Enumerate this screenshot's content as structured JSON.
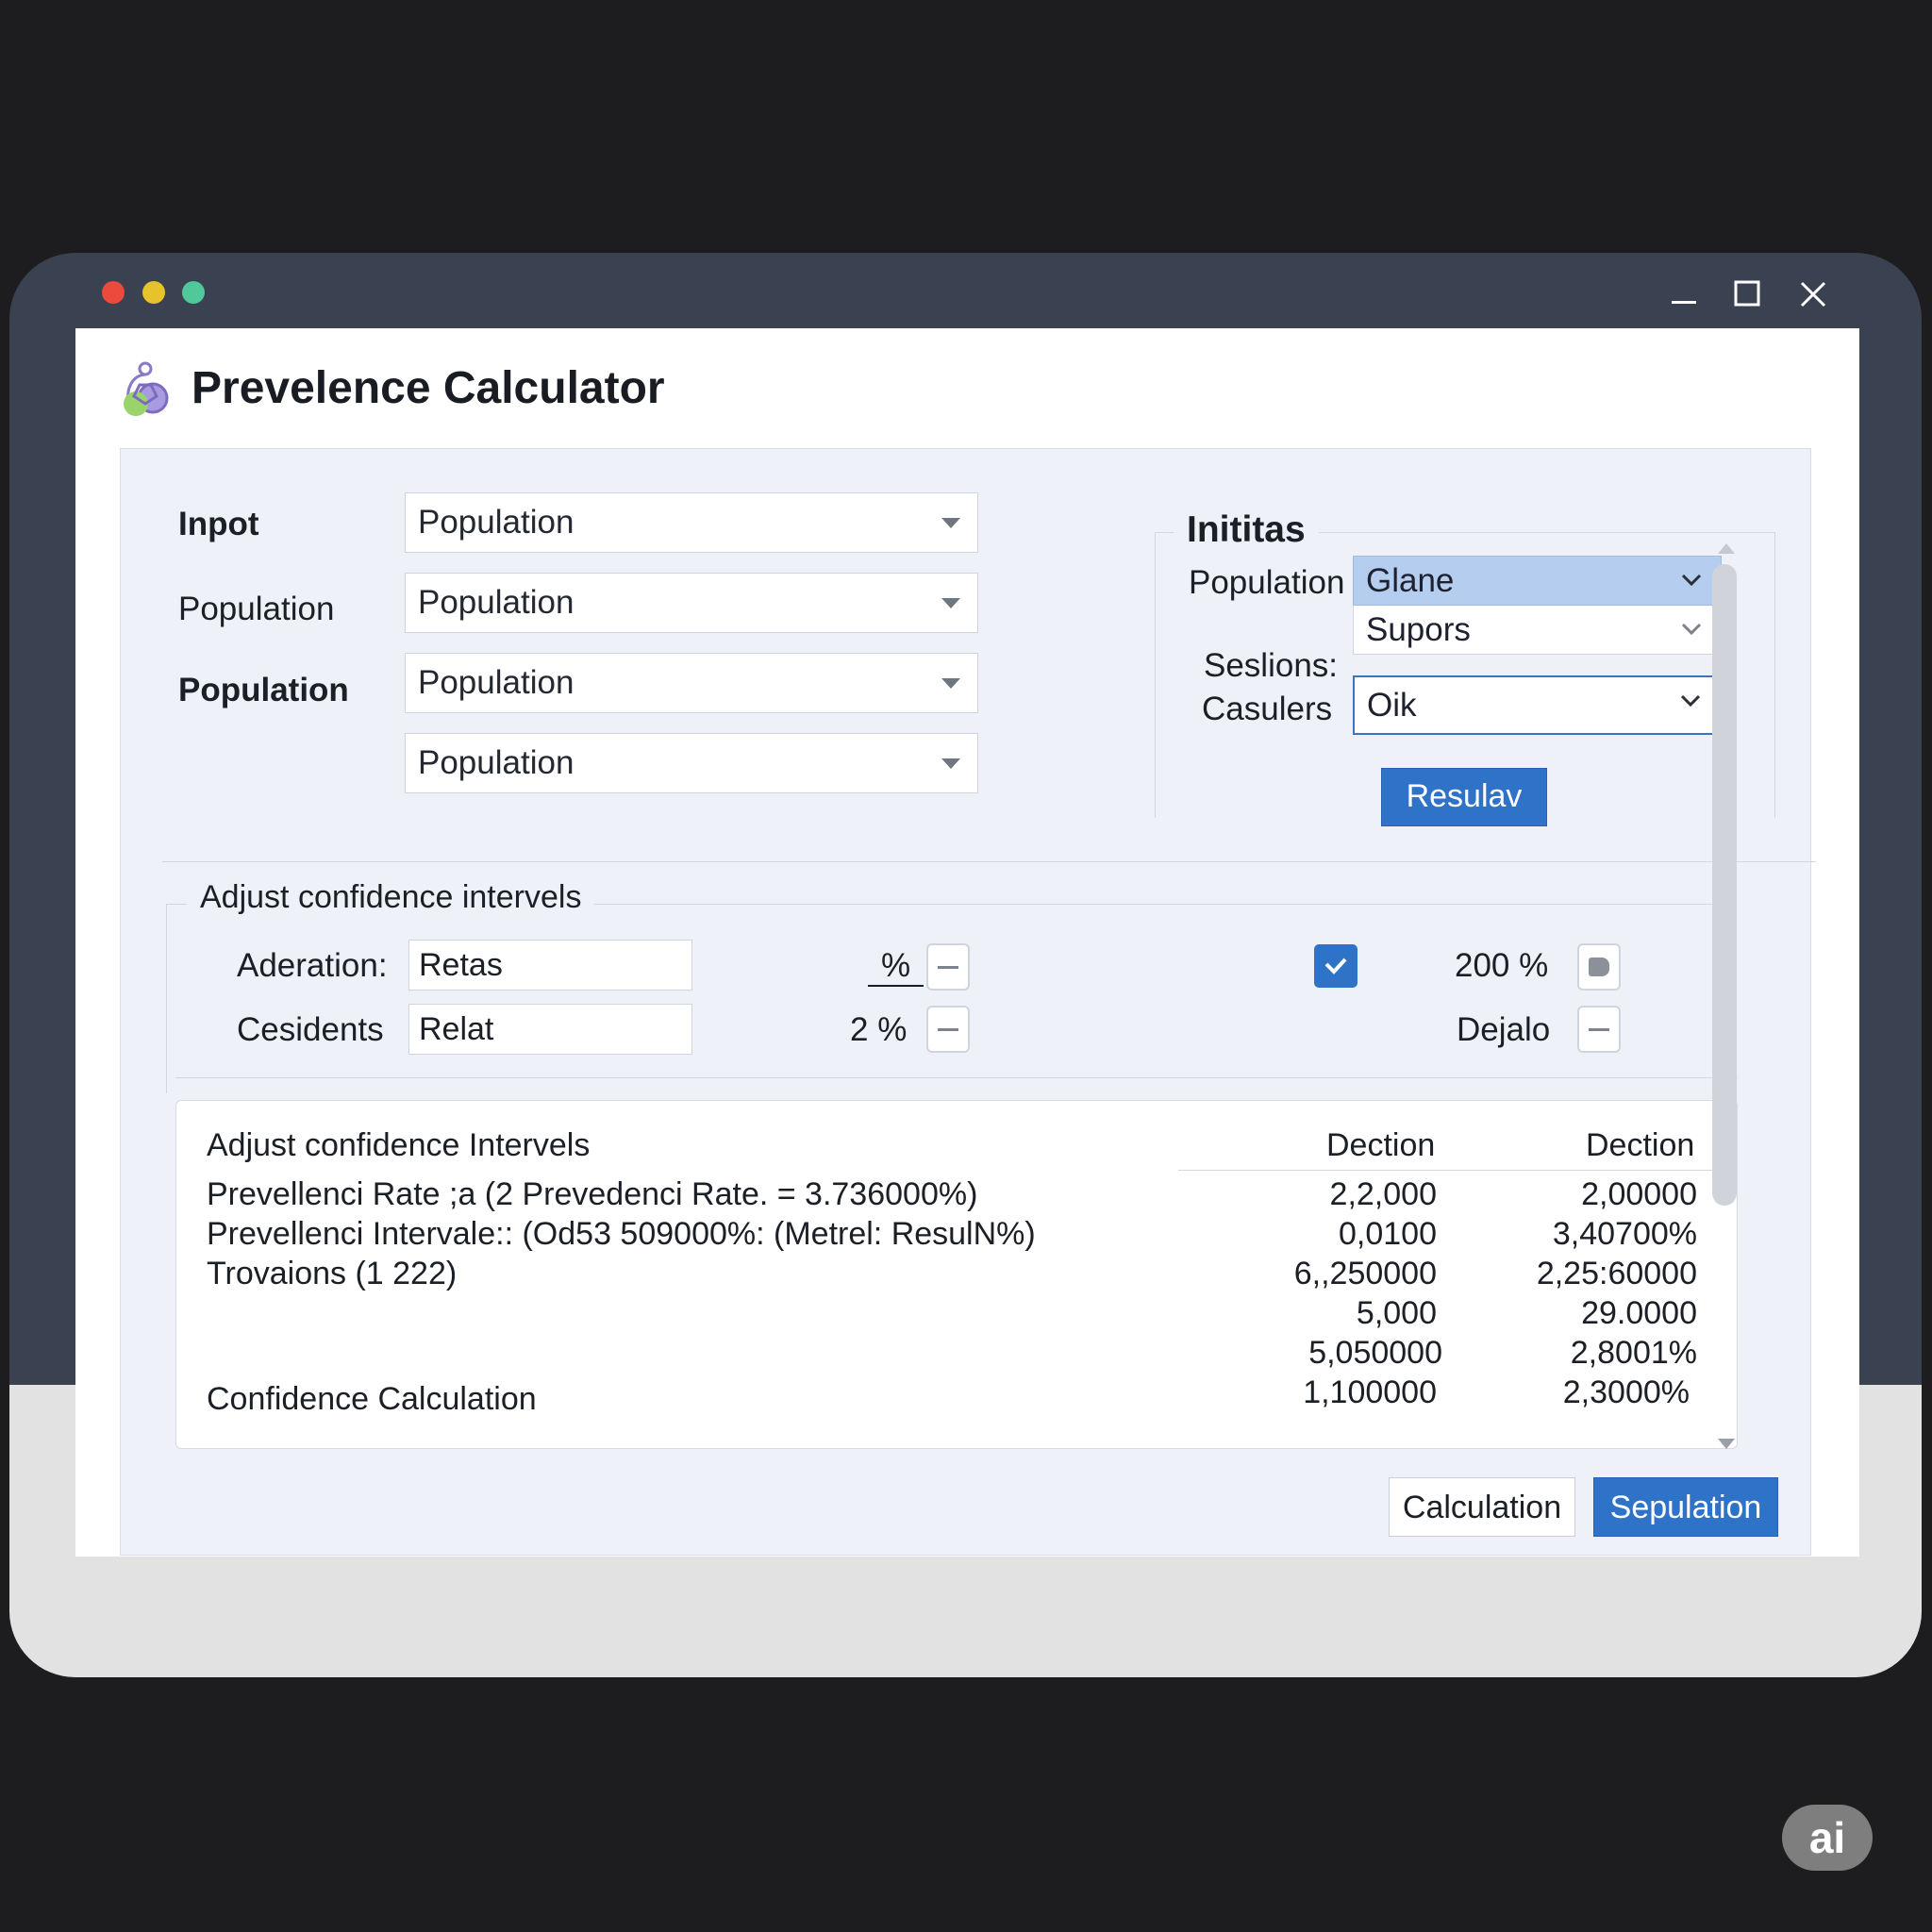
{
  "app": {
    "title": "Prevelence Calculator",
    "icon": "molecule-logo-icon",
    "window_controls": [
      "minimize-icon",
      "maximize-icon",
      "close-icon"
    ]
  },
  "input_section": {
    "labels": [
      "Inpot",
      "Population",
      "Population"
    ],
    "selects": [
      "Population",
      "Population",
      "Population",
      "Population"
    ]
  },
  "initials_group": {
    "title": "Inititas",
    "population_label": "Population",
    "sessions_label_line1": "Seslions:",
    "sessions_label_line2": "Casulers",
    "dropdown_highlighted": "Glane",
    "dropdown_option": "Supors",
    "dropdown_focused": "Oik",
    "result_button": "Resulav"
  },
  "confidence_section": {
    "title": "Adjust confidence intervels",
    "row1": {
      "label": "Aderation:",
      "value": "Retas",
      "unit": "%",
      "percent": "200 %",
      "checked": true
    },
    "row2": {
      "label": "Cesidents",
      "value": "Relat",
      "unit": "2 %",
      "extra_label": "Dejalo"
    }
  },
  "results": {
    "title": "Adjust confidence Intervels",
    "col1_header": "Dection",
    "col2_header": "Dection",
    "lines": [
      "Prevellenci Rate ;a (2 Prevedenci Rate. = 3.736000%)",
      "Prevellenci Intervale:: (Od53 509000%: (Metrel: ResulN%)",
      "Trovaions (1 222)"
    ],
    "footer_label": "Confidence Calculation",
    "col1_values": [
      "2,2,000",
      "0,0100",
      "6,,250000",
      "5,000",
      "5,050000",
      "1,100000"
    ],
    "col2_values": [
      "2,00000",
      "3,40700%",
      "2,25:60000",
      "29.0000",
      "2,8001%",
      "2,3000%"
    ]
  },
  "footer_buttons": {
    "secondary": "Calculation",
    "primary": "Sepulation"
  },
  "watermark": "ai",
  "colors": {
    "accent": "#2f73c8",
    "highlight": "#b5cdef",
    "window_frame": "#3a4150",
    "panel": "#eef1f7",
    "dot_red": "#ec4a3c",
    "dot_yellow": "#e6c32b",
    "dot_green": "#50c89a"
  }
}
